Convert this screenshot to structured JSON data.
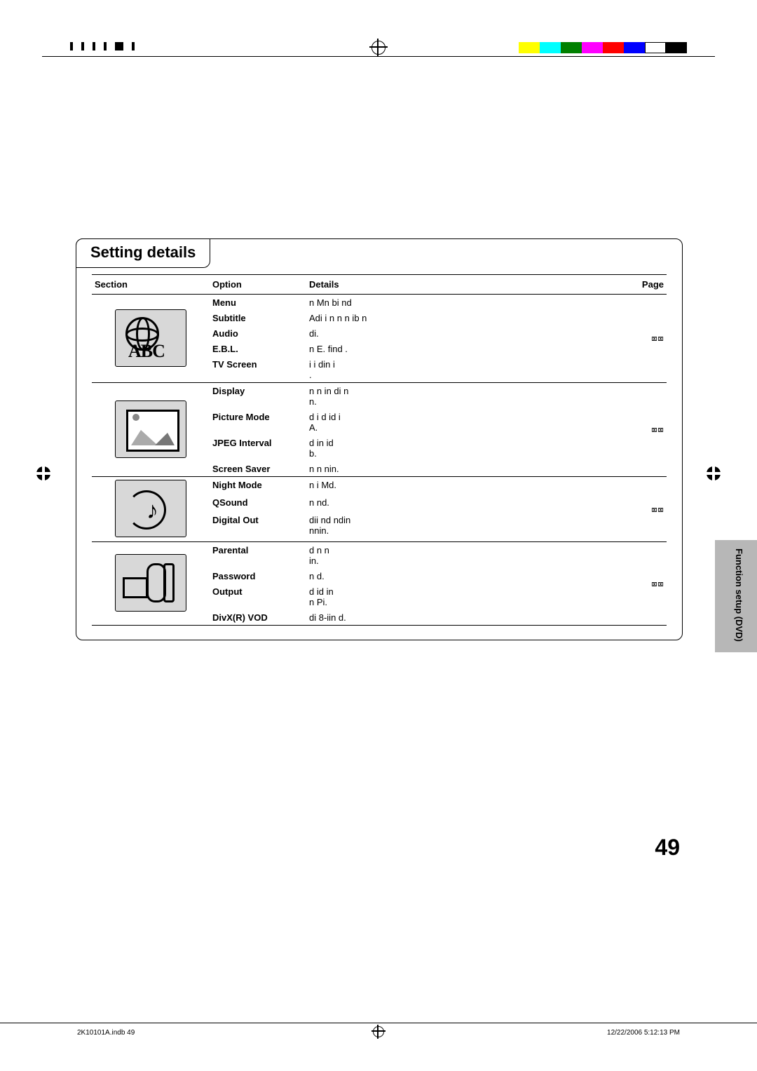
{
  "title": "Setting details",
  "headers": {
    "section": "Section",
    "option": "Option",
    "details": "Details",
    "page": "Page"
  },
  "page_number": "49",
  "side_tab_label": "Function setup (DVD)",
  "footer_left": "2K10101A.indb   49",
  "footer_right": "12/22/2006   5:12:13 PM",
  "page_refs": {
    "g1": "⌧⌧",
    "g2": "⌧⌧",
    "g3": "⌧⌧",
    "g4": "⌧⌧"
  },
  "rows": [
    {
      "opt": "Menu",
      "det": "n Mn bi nd"
    },
    {
      "opt": "Subtitle",
      "det": "Adi i  n n n  ib n"
    },
    {
      "opt": "Audio",
      "det": "di."
    },
    {
      "opt": "E.B.L.",
      "det": "n   E. find ."
    },
    {
      "opt": "TV Screen",
      "det": "i i din   i\n."
    },
    {
      "opt": "Display",
      "det": "n n   in  di n\nn."
    },
    {
      "opt": "Picture Mode",
      "det": "d i d  id i\nA."
    },
    {
      "opt": "JPEG Interval",
      "det": "d in  id\nb."
    },
    {
      "opt": "Screen Saver",
      "det": "n   n  nin."
    },
    {
      "opt": "Night Mode",
      "det": "n   i Md."
    },
    {
      "opt": "QSound",
      "det": "n  nd."
    },
    {
      "opt": "Digital Out",
      "det": "dii  nd  ndin\nnnin."
    },
    {
      "opt": "Parental",
      "det": "d n  n\nin."
    },
    {
      "opt": "Password",
      "det": "n  d."
    },
    {
      "opt": "Output",
      "det": "d id  in\nn  Pi."
    },
    {
      "opt": "DivX(R) VOD",
      "det": "di  8-iin d."
    }
  ]
}
